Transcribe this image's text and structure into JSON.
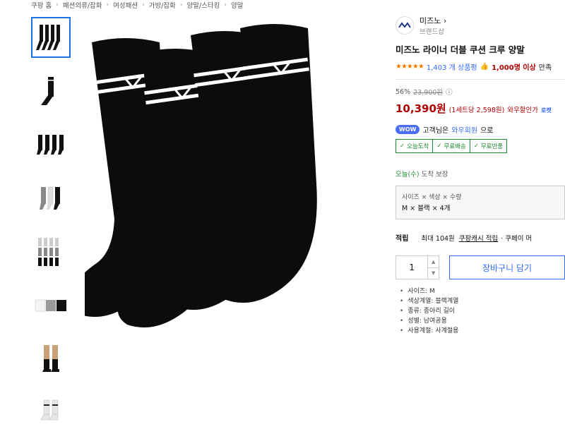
{
  "breadcrumb": [
    "쿠팡 홈",
    "패션의류/잡화",
    "여성패션",
    "가방/잡화",
    "양말/스타킹",
    "양말"
  ],
  "brand": {
    "name": "미즈노",
    "sub": "브랜드샵"
  },
  "product": {
    "title": "미즈노 라이너 더블 쿠션 크루 양말",
    "stars": "★★★★★",
    "review_count": "1,403 개 상품평",
    "buy_count": "1,000명 이상",
    "buy_suffix": "만족",
    "discount": "56%",
    "original_price": "23,900원",
    "price": "10,390원",
    "unit_price": "(1세트당 2,598원)",
    "wow_price": "와우할인가",
    "rocket": "로켓"
  },
  "wow": {
    "badge": "WOW",
    "text1": "고객님은",
    "link": "와우회원",
    "text2": "으로"
  },
  "tags": [
    "오늘도착",
    "무료배송",
    "무료반품"
  ],
  "arrival": {
    "day": "오늘(수)",
    "text": "도착 보장"
  },
  "option": {
    "label": "사이즈 × 색상 × 수량",
    "value": "M × 블랙 × 4개"
  },
  "points": {
    "label": "적립",
    "text": "최대 104원",
    "link": "쿠팡캐시 적립",
    "more": "· 쿠페이 머"
  },
  "quantity": "1",
  "cart_button": "장바구니 담기",
  "specs": [
    "사이즈: M",
    "색상계열: 블랙계열",
    "종류: 종아리 길이",
    "성별: 남여공용",
    "사용계절: 사계절용"
  ],
  "colors": {
    "accent": "#346aff",
    "price": "#ae0000",
    "green": "#1e8b2e"
  }
}
